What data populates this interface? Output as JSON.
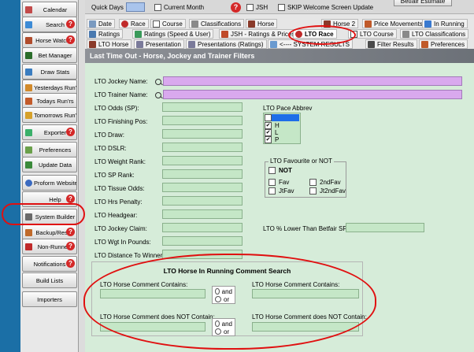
{
  "sidebar": {
    "items": [
      {
        "label": "Calendar",
        "icon": "calendar-icon",
        "color": "#c34a4a"
      },
      {
        "label": "Search",
        "icon": "search-icon",
        "color": "#3c8bd6"
      },
      {
        "label": "Horse Watcher",
        "icon": "horse-watcher-icon",
        "color": "#b04c2c"
      },
      {
        "label": "Bet Manager",
        "icon": "bet-manager-icon",
        "color": "#2a6d2a"
      },
      {
        "label": "Draw Stats",
        "icon": "draw-stats-icon",
        "color": "#3a7dc0"
      },
      {
        "label": "Yesterdays Run'rs",
        "icon": "yesterdays-runners-icon",
        "color": "#d28a2a"
      },
      {
        "label": "Todays Run'rs",
        "icon": "todays-runners-icon",
        "color": "#c35b2a"
      },
      {
        "label": "Tomorrows Run'rs",
        "icon": "tomorrows-runners-icon",
        "color": "#d6a12a"
      },
      {
        "label": "Exporter",
        "icon": "exporter-icon",
        "color": "#3ab06a"
      },
      {
        "label": "Preferences",
        "icon": "preferences-icon",
        "color": "#6aa04a"
      },
      {
        "label": "Update Data",
        "icon": "update-data-icon",
        "color": "#3a8a3a"
      },
      {
        "label": "Proform Website",
        "icon": "globe-icon",
        "color": "#3a6ac0"
      },
      {
        "label": "Help",
        "icon": "help-icon",
        "color": "#2a5ab0"
      },
      {
        "label": "System Builder",
        "icon": "system-builder-icon",
        "color": "#6a6a6a"
      },
      {
        "label": "Backup/Restre",
        "icon": "backup-icon",
        "color": "#c06a2a"
      },
      {
        "label": "Non-Runners",
        "icon": "non-runners-icon",
        "color": "#c02a2a"
      },
      {
        "label": "Notifications",
        "icon": "",
        "color": ""
      },
      {
        "label": "Build Lists",
        "icon": "",
        "color": ""
      },
      {
        "label": "Importers",
        "icon": "",
        "color": ""
      }
    ],
    "help_badge": "?"
  },
  "topbar": {
    "quick_days_label": "Quick Days",
    "current_month_label": "Current Month",
    "jsh_label": "JSH",
    "skip_welcome_label": "SKIP Welcome Screen Update",
    "betfair_estimate_label": "Betfair Estimate",
    "help_badge": "?"
  },
  "tabs": {
    "row1": [
      "Date",
      "Race",
      "Course",
      "Classifications",
      "Horse",
      "Horse 2",
      "Price Movements",
      "In Running"
    ],
    "row2": [
      "Ratings",
      "Ratings (Speed & User)",
      "JSH - Ratings & Prices",
      "LTO Race",
      "LTO Course",
      "LTO Classifications"
    ],
    "row3": [
      "LTO Horse",
      "Presentation",
      "Presentations (Ratings)",
      "<---- SYSTEM RESULTS",
      "Filter Results",
      "Preferences"
    ]
  },
  "panel": {
    "title": "Last Time Out - Horse, Jockey and Trainer Filters",
    "fields": [
      "LTO Jockey Name:",
      "LTO Trainer Name:",
      "LTO Odds (SP):",
      "LTO Finishing Pos:",
      "LTO Draw:",
      "LTO DSLR:",
      "LTO Weight Rank:",
      "LTO SP Rank:",
      "LTO Tissue Odds:",
      "LTO Hrs Penalty:",
      "LTO Headgear:",
      "LTO Jockey Claim:",
      "LTO Wgt In Pounds:",
      "LTO Distance To Winner:"
    ],
    "pace": {
      "label": "LTO Pace Abbrev",
      "items": [
        {
          "text": "",
          "checked": true,
          "selected": true
        },
        {
          "text": "H",
          "checked": true,
          "selected": false
        },
        {
          "text": "L",
          "checked": true,
          "selected": false
        },
        {
          "text": "P",
          "checked": true,
          "selected": false
        }
      ]
    },
    "favourite": {
      "title": "LTO Favourite or NOT",
      "not_label": "NOT",
      "options": [
        "Fav",
        "2ndFav",
        "JtFav",
        "Jt2ndFav"
      ]
    },
    "betfair_label": "LTO % Lower Than Betfair SP:",
    "comment": {
      "title": "LTO Horse In Running Comment Search",
      "contains_label": "LTO Horse Comment Contains:",
      "not_contains_label": "LTO Horse Comment does NOT Contain:",
      "and_label": "and",
      "or_label": "or"
    }
  },
  "colors": {
    "input_green": "#c5e7c7",
    "input_pink": "#d9a9ee",
    "panel_bg": "#d6ecd9",
    "annotation_red": "#e01010"
  }
}
